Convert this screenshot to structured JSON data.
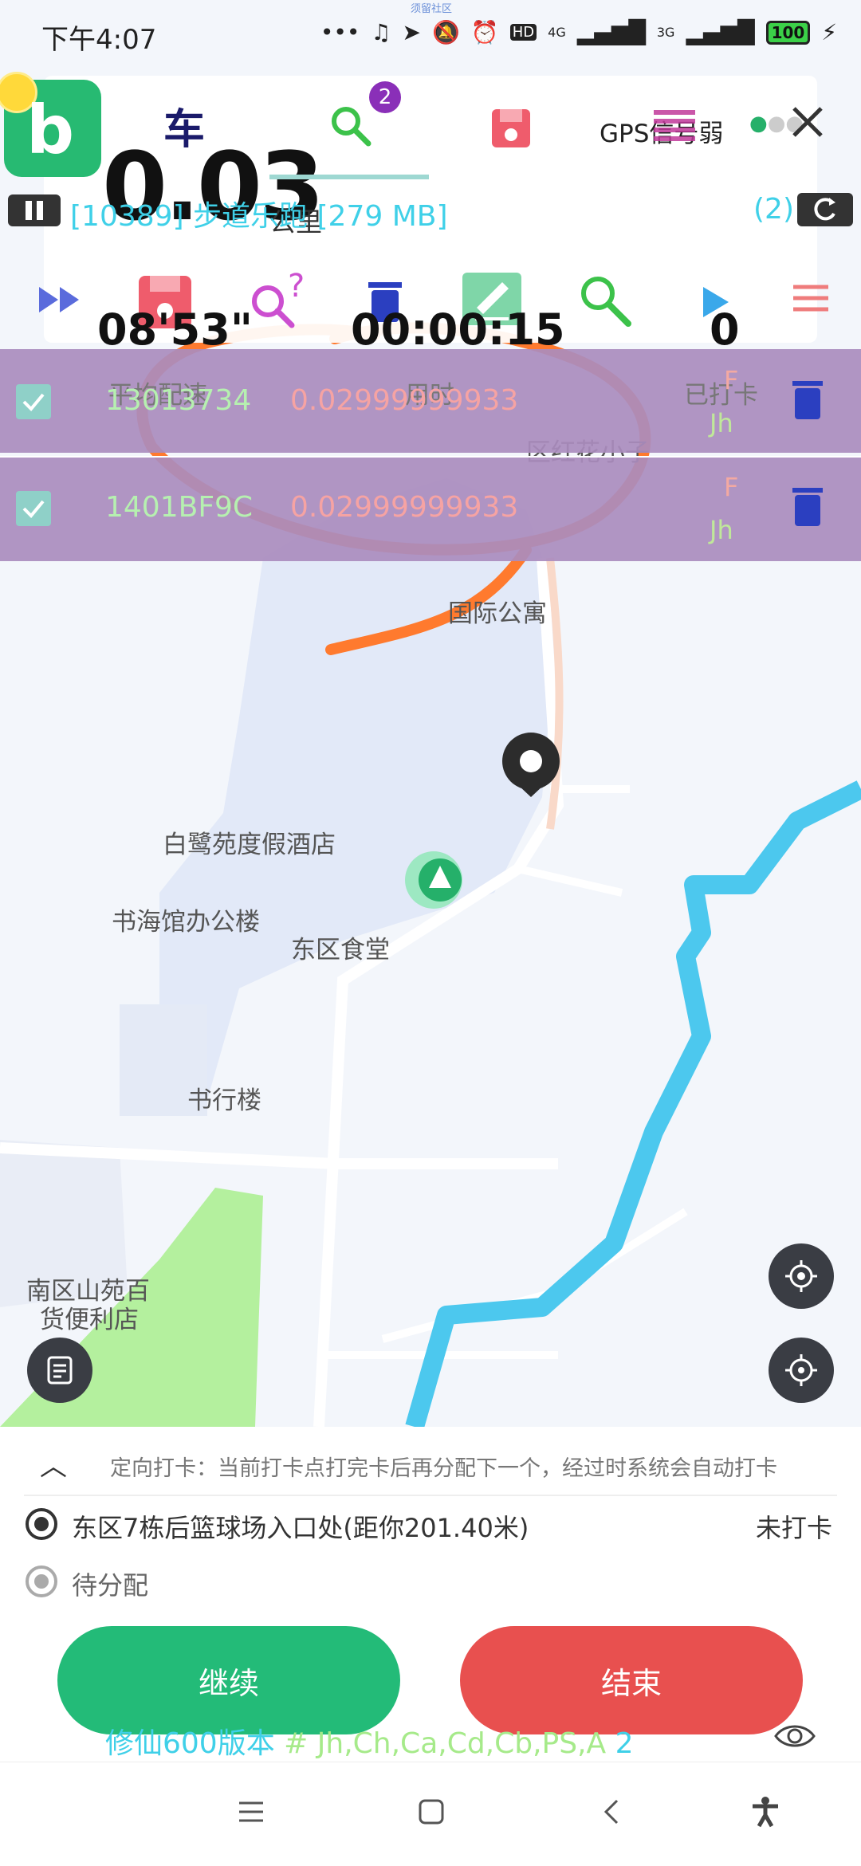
{
  "status_bar": {
    "time": "下午4:07",
    "mini_label": "须留社区",
    "icons": [
      "dots-icon",
      "headphone-icon",
      "location-arrow-icon",
      "mute-bell-icon",
      "alarm-icon",
      "hd-icon",
      "signal-4g-icon",
      "signal-3g-icon",
      "battery-icon",
      "charging-icon"
    ],
    "battery": "100",
    "net1": "4G",
    "net2": "3G"
  },
  "header": {
    "big_distance": "0.03",
    "unit_under": "公里",
    "small_glyph": "车",
    "search_badge": "2",
    "gps_status": "GPS信号弱",
    "run_info": "[10389] 步道乐跑 [279 MB]",
    "count": "(2)",
    "pace_value": "08'53\"",
    "pace_label": "平均配速",
    "time_value": "00:00:15",
    "time_label": "用时",
    "checked_value": "0",
    "checked_label": "已打卡"
  },
  "rows": [
    {
      "id": "13013734",
      "value": "0.02999999933",
      "flag": "F",
      "tag": "Jh"
    },
    {
      "id": "1401BF9C",
      "value": "0.02999999933",
      "flag": "F",
      "tag": "Jh"
    }
  ],
  "map_labels": {
    "l1": "区红花小子",
    "l2": "国际公寓",
    "l3": "白鹭苑度假酒店",
    "l4": "书海馆办公楼",
    "l5": "东区食堂",
    "l6": "书行楼",
    "l7": "南区山苑百",
    "l8": "货便利店"
  },
  "panel": {
    "hint": "定向打卡：当前打卡点打完卡后再分配下一个，经过时系统会自动打卡",
    "point1": "东区7栋后篮球场入口处(距你201.40米)",
    "point1_status": "未打卡",
    "point2": "待分配",
    "continue": "继续",
    "end": "结束",
    "version_cyan": "修仙600版本 ",
    "version_green": "# Jh,Ch,Ca,Cd,Cb,PS,A",
    "version_num": " 2"
  },
  "colors": {
    "green": "#27ba72",
    "red": "#e8504f",
    "cyan": "#3fd0e8",
    "purple_band": "#a98cbe",
    "river": "#4cc8ee",
    "annotation": "#ff7a2e"
  }
}
